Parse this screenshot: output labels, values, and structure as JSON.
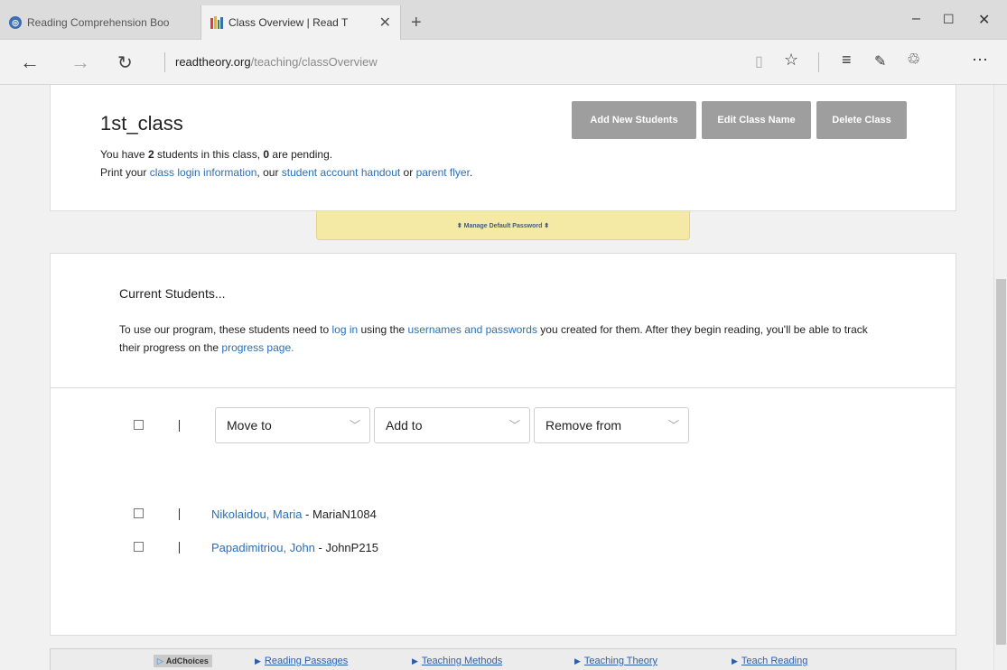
{
  "browser": {
    "tabs": [
      {
        "title": "Reading Comprehension Boo",
        "favicon": "readtheory-round-icon"
      },
      {
        "title": "Class Overview | Read T",
        "favicon": "books-icon"
      }
    ],
    "new_tab_glyph": "+",
    "window_controls": {
      "minimize": "–",
      "maximize": "☐",
      "close": "✕"
    },
    "address": {
      "domain": "readtheory.org",
      "path": "/teaching/classOverview"
    }
  },
  "class_card": {
    "title": "1st_class",
    "info_line1_prefix": "You have ",
    "student_count": "2",
    "info_line1_mid": " students in this class, ",
    "pending_count": "0",
    "info_line1_suffix": " are pending.",
    "info_line2_prefix": "Print your ",
    "link_login_info": "class login information",
    "info_line2_mid1": ", our ",
    "link_handout": "student account handout",
    "info_line2_mid2": " or ",
    "link_parent_flyer": "parent flyer",
    "info_line2_suffix": ".",
    "buttons": {
      "add_students": "Add New Students",
      "edit_name": "Edit Class Name",
      "delete_class": "Delete Class"
    }
  },
  "manage_password": "⬍ Manage Default Password ⬍",
  "students_card": {
    "title": "Current Students...",
    "text_p1": "To use our program, these students need to ",
    "link_log_in": "log in",
    "text_p2": " using the ",
    "link_credentials": "usernames and passwords",
    "text_p3": " you created for them. After they begin reading, you'll be able to track their progress on the ",
    "link_progress": "progress page.",
    "selects": {
      "move_to": "Move to",
      "add_to": "Add to",
      "remove_from": "Remove from"
    },
    "students": [
      {
        "name": "Nikolaidou, Maria",
        "username": "MariaN1084"
      },
      {
        "name": "Papadimitriou, John",
        "username": "JohnP215"
      }
    ],
    "username_separator": " - "
  },
  "ad_bar": {
    "adchoices": "AdChoices",
    "links": [
      "Reading Passages",
      "Teaching Methods",
      "Teaching Theory",
      "Teach Reading"
    ]
  },
  "colors": {
    "link": "#2a6fb6",
    "button_grey": "#9e9e9e",
    "password_tab": "#f4eaa6"
  }
}
